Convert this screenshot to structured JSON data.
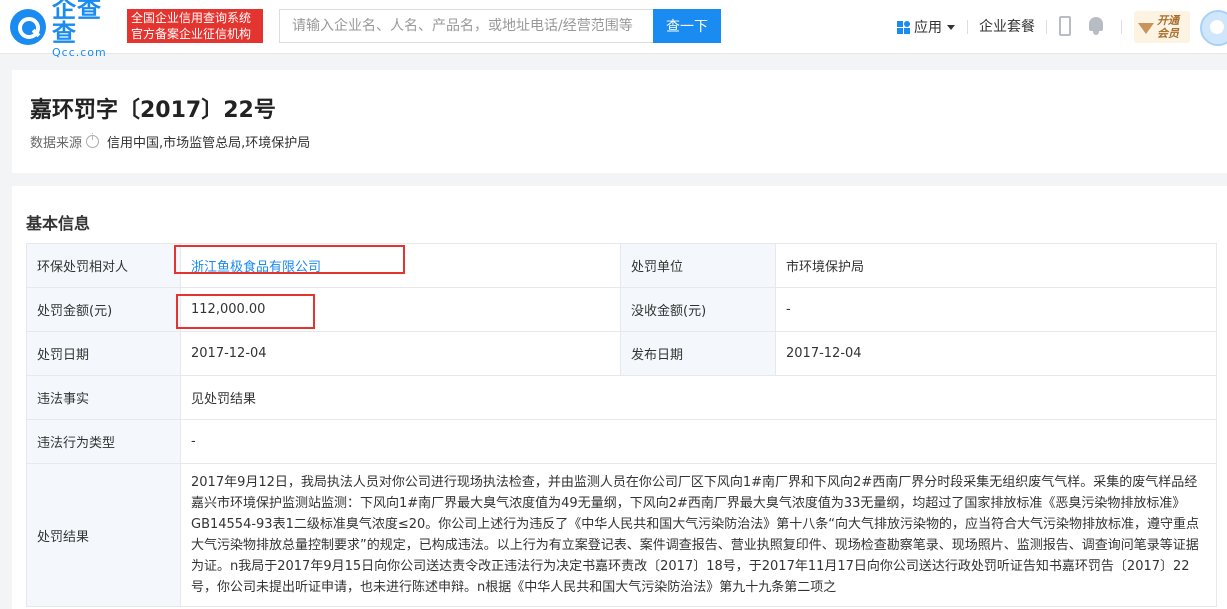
{
  "header": {
    "logo_cn": "企查查",
    "logo_en": "Qcc.com",
    "slogan_line1": "全国企业信用查询系统",
    "slogan_line2": "官方备案企业征信机构",
    "search_placeholder": "请输入企业名、人名、产品名，或地址电话/经营范围等",
    "search_button": "查一下",
    "apps_label": "应用",
    "plan_label": "企业套餐",
    "vip_line1": "开通",
    "vip_line2": "会员"
  },
  "page": {
    "title": "嘉环罚字〔2017〕22号",
    "source_label": "数据来源",
    "source_value": "信用中国,市场监管总局,环境保护局"
  },
  "basic_info": {
    "section_title": "基本信息",
    "rows": {
      "party_label": "环保处罚相对人",
      "party_value": "浙江鱼极食品有限公司",
      "unit_label": "处罚单位",
      "unit_value": "市环境保护局",
      "amount_label": "处罚金额(元)",
      "amount_value": "112,000.00",
      "confiscate_label": "没收金额(元)",
      "confiscate_value": "-",
      "date_label": "处罚日期",
      "date_value": "2017-12-04",
      "publish_label": "发布日期",
      "publish_value": "2017-12-04",
      "fact_label": "违法事实",
      "fact_value": "见处罚结果",
      "type_label": "违法行为类型",
      "type_value": "-",
      "result_label": "处罚结果",
      "result_value": "2017年9月12日，我局执法人员对你公司进行现场执法检查，并由监测人员在你公司厂区下风向1#南厂界和下风向2#西南厂界分时段采集无组织废气气样。采集的废气样品经嘉兴市环境保护监测站监测：下风向1#南厂界最大臭气浓度值为49无量纲，下风向2#西南厂界最大臭气浓度值为33无量纲，均超过了国家排放标准《恶臭污染物排放标准》GB14554-93表1二级标准臭气浓度≤20。你公司上述行为违反了《中华人民共和国大气污染防治法》第十八条“向大气排放污染物的，应当符合大气污染物排放标准，遵守重点大气污染物排放总量控制要求”的规定，已构成违法。以上行为有立案登记表、案件调查报告、营业执照复印件、现场检查勘察笔录、现场照片、监测报告、调查询问笔录等证据为证。n我局于2017年9月15日向你公司送达责令改正违法行为决定书嘉环责改〔2017〕18号，于2017年11月17日向你公司送达行政处罚听证告知书嘉环罚告〔2017〕22号，你公司未提出听证申请，也未进行陈述申辩。n根据《中华人民共和国大气污染防治法》第九十九条第二项之"
    }
  },
  "colors": {
    "brand": "#1a8bf0",
    "highlight": "#e3342f",
    "label_bg": "#f4f8fc"
  }
}
